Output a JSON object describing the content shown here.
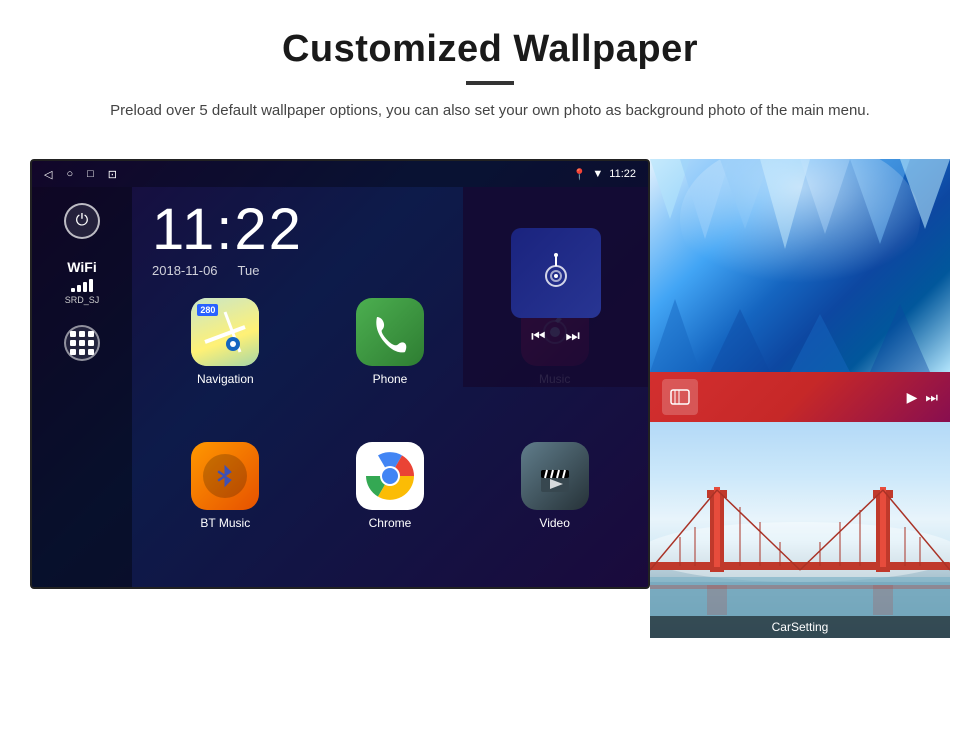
{
  "header": {
    "title": "Customized Wallpaper",
    "subtitle": "Preload over 5 default wallpaper options, you can also set your own photo as background photo of the main menu."
  },
  "android": {
    "status_bar": {
      "nav_icons": [
        "◁",
        "○",
        "□",
        "⊡"
      ],
      "time": "11:22",
      "status_icons": [
        "📍",
        "▼"
      ]
    },
    "clock": {
      "time": "11:22",
      "date": "2018-11-06",
      "day": "Tue"
    },
    "wifi": {
      "label": "WiFi",
      "ssid": "SRD_SJ"
    },
    "apps": [
      {
        "label": "Navigation",
        "icon": "nav"
      },
      {
        "label": "Phone",
        "icon": "phone"
      },
      {
        "label": "Music",
        "icon": "music"
      },
      {
        "label": "BT Music",
        "icon": "bt"
      },
      {
        "label": "Chrome",
        "icon": "chrome"
      },
      {
        "label": "Video",
        "icon": "video"
      }
    ],
    "nav_badge": "280"
  },
  "wallpapers": {
    "car_setting_label": "CarSetting"
  }
}
